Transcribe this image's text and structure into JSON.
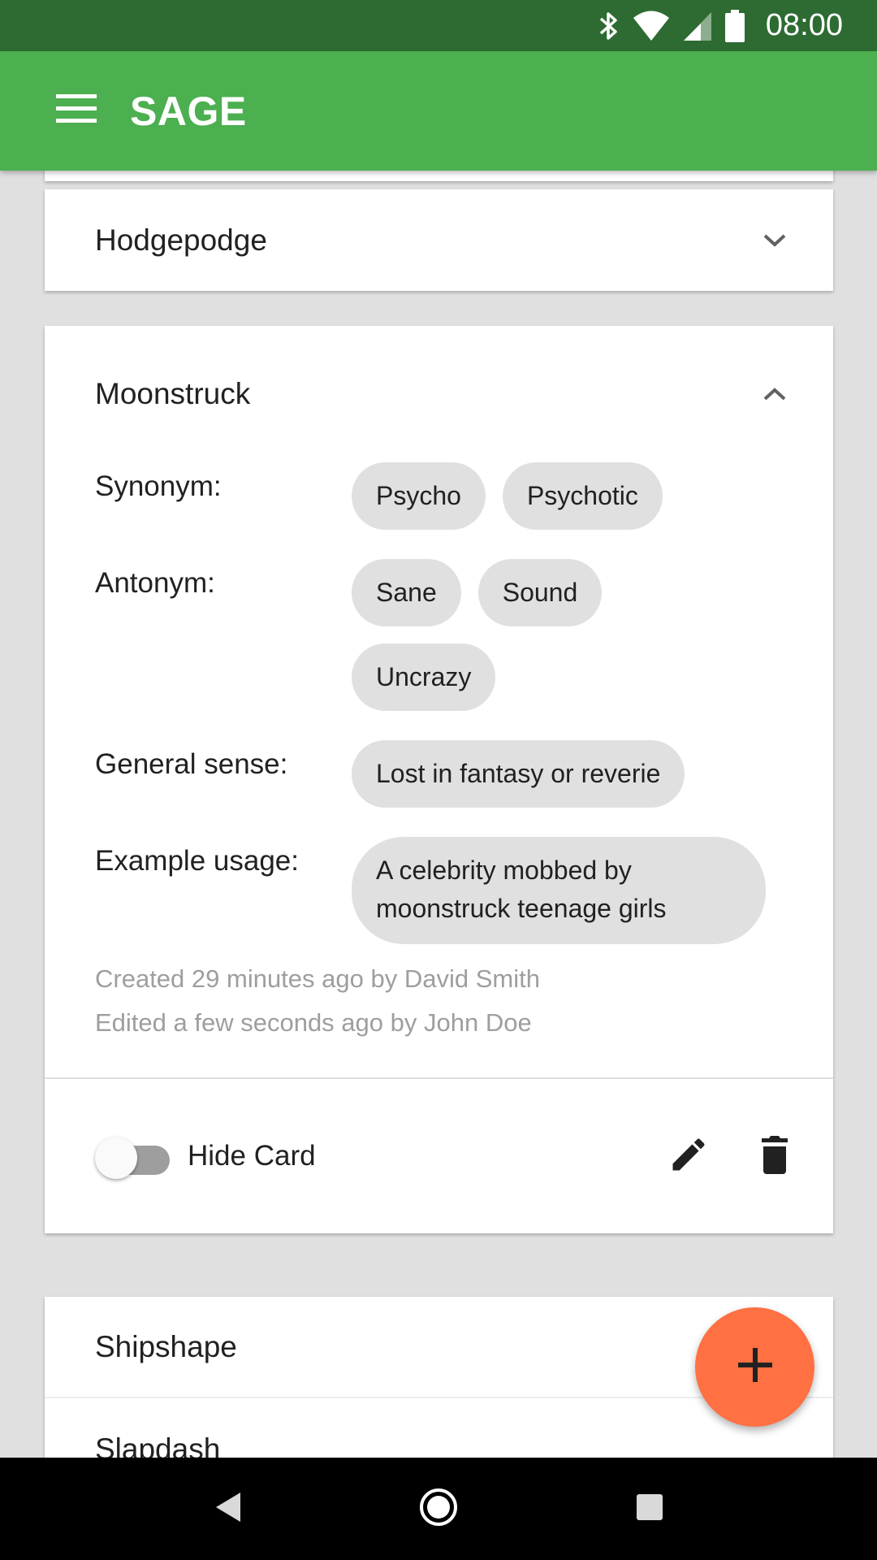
{
  "status_bar": {
    "time": "08:00"
  },
  "app_bar": {
    "title": "SAGE"
  },
  "cards": {
    "hodgepodge": {
      "word": "Hodgepodge"
    },
    "moonstruck": {
      "word": "Moonstruck",
      "synonym_label": "Synonym:",
      "synonyms": [
        "Psycho",
        "Psychotic"
      ],
      "antonym_label": "Antonym:",
      "antonyms": [
        "Sane",
        "Sound",
        "Uncrazy"
      ],
      "general_sense_label": "General sense:",
      "general_sense": "Lost in fantasy or reverie",
      "example_label": "Example usage:",
      "example": "A celebrity mobbed by moonstruck teenage girls",
      "created": "Created 29 minutes ago by David Smith",
      "edited": "Edited a few seconds ago by John Doe",
      "hide_card_label": "Hide Card",
      "hide_card_on": false
    },
    "list": [
      {
        "word": "Shipshape"
      },
      {
        "word": "Slapdash"
      }
    ]
  },
  "icons": {
    "menu": "menu-icon",
    "chevron_down": "chevron-down-icon",
    "chevron_up": "chevron-up-icon",
    "edit": "pencil-icon",
    "delete": "trash-icon",
    "add": "plus-icon"
  },
  "colors": {
    "status_bar": "#2e6b32",
    "app_bar": "#4caf50",
    "fab": "#ff7043",
    "chip": "#e0e0e0",
    "background": "#e0e0e0"
  }
}
